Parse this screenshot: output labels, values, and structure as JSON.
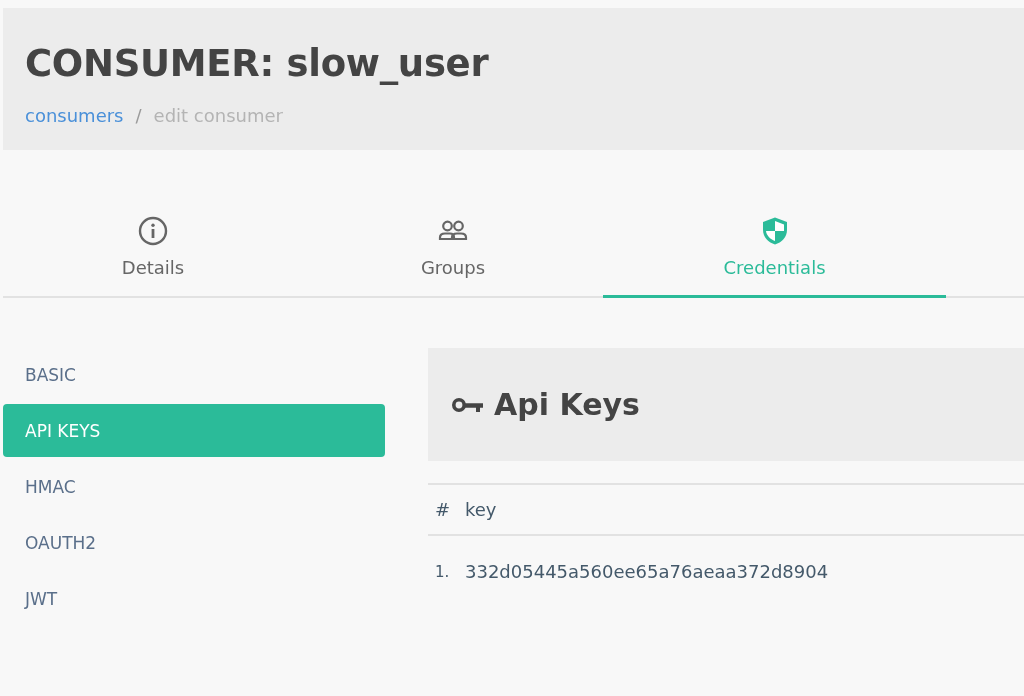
{
  "header": {
    "title": "CONSUMER: slow_user",
    "breadcrumb": [
      {
        "label": "consumers",
        "kind": "link"
      },
      {
        "label": "edit consumer",
        "kind": "current"
      }
    ],
    "separator": "/"
  },
  "tabs": [
    {
      "label": "Details",
      "kind": "info",
      "selected": false
    },
    {
      "label": "Groups",
      "kind": "people",
      "selected": false
    },
    {
      "label": "Credentials",
      "kind": "shield",
      "selected": true
    }
  ],
  "sidebar": {
    "items": [
      {
        "label": "BASIC",
        "selected": false
      },
      {
        "label": "API KEYS",
        "selected": true
      },
      {
        "label": "HMAC",
        "selected": false
      },
      {
        "label": "OAUTH2",
        "selected": false
      },
      {
        "label": "JWT",
        "selected": false
      }
    ]
  },
  "panel": {
    "title": "Api Keys",
    "table": {
      "columns": [
        "#",
        "key"
      ],
      "rows": [
        {
          "index": "1.",
          "key": "332d05445a560ee65a76aeaa372d8904"
        }
      ]
    }
  }
}
